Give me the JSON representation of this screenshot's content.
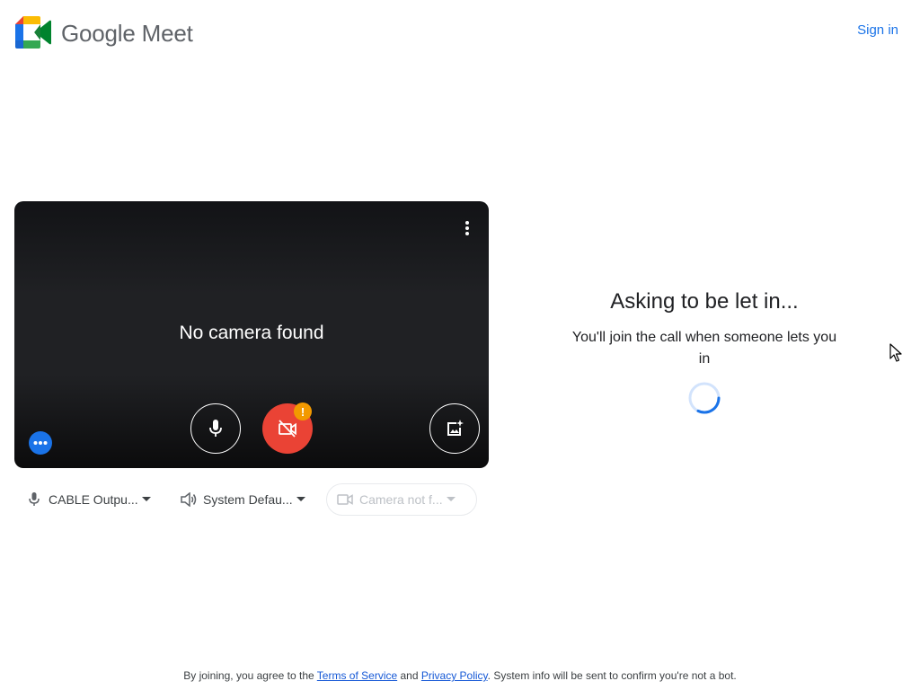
{
  "header": {
    "brand_name": "Google Meet",
    "sign_in_label": "Sign in"
  },
  "video_preview": {
    "status_text": "No camera found",
    "buttons": {
      "more_options_icon": "more-vert-icon",
      "microphone_icon": "mic-icon",
      "camera_icon": "videocam-off-icon",
      "camera_warning": "!",
      "effects_icon": "visual-effects-icon",
      "dots_icon": "more-horiz-icon"
    }
  },
  "devices": {
    "microphone": "CABLE Outpu...",
    "speaker": "System Defau...",
    "camera": "Camera not f..."
  },
  "join_status": {
    "title": "Asking to be let in...",
    "subtitle": "You'll join the call when someone lets you in"
  },
  "footer": {
    "prefix": "By joining, you agree to the ",
    "terms_label": "Terms of Service",
    "and_text": " and ",
    "privacy_label": "Privacy Policy",
    "suffix": ". System info will be sent to confirm you're not a bot."
  },
  "colors": {
    "accent_blue": "#1a73e8",
    "camera_off_red": "#ea4335",
    "warning_orange": "#f29900",
    "tile_background": "#202124"
  }
}
